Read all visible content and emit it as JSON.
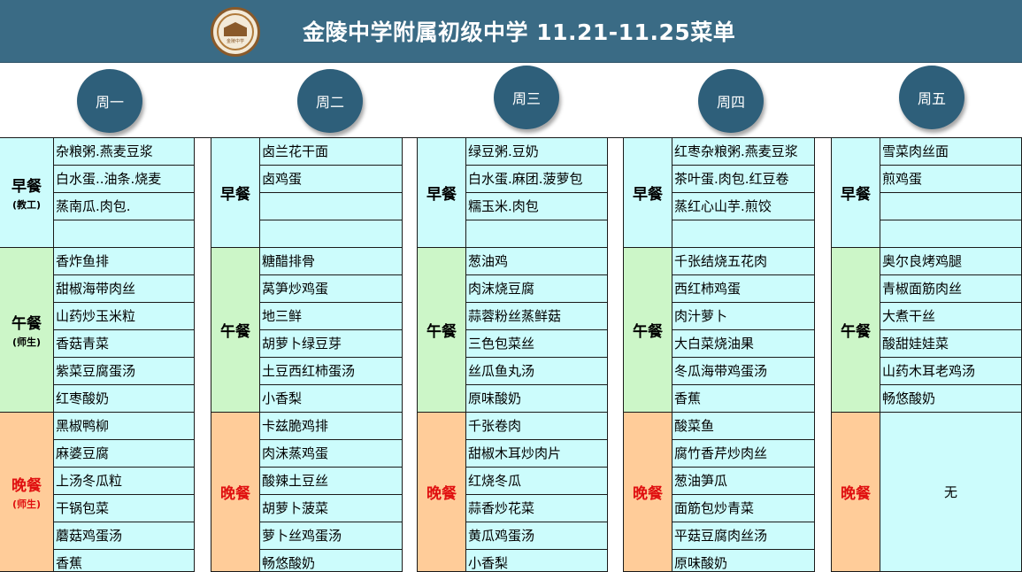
{
  "header": {
    "title": "金陵中学附属初级中学 11.21-11.25菜单",
    "logo_text": "金陵中学",
    "color": "#3a6b85"
  },
  "days": [
    {
      "name": "周一",
      "breakfast": {
        "label": "早餐",
        "sub": "(教工)",
        "items": [
          "杂粮粥.燕麦豆浆",
          "白水蛋..油条.烧麦",
          "蒸南瓜.肉包.",
          ""
        ]
      },
      "lunch": {
        "label": "午餐",
        "sub": "(师生)",
        "items": [
          "香炸鱼排",
          "甜椒海带肉丝",
          "山药炒玉米粒",
          "香菇青菜",
          "紫菜豆腐蛋汤",
          "红枣酸奶"
        ]
      },
      "dinner": {
        "label": "晚餐",
        "sub": "(师生)",
        "items": [
          "黑椒鸭柳",
          "麻婆豆腐",
          "上汤冬瓜粒",
          "干锅包菜",
          "蘑菇鸡蛋汤",
          "香蕉"
        ]
      }
    },
    {
      "name": "周二",
      "breakfast": {
        "label": "早餐",
        "sub": "",
        "items": [
          "卤兰花干面",
          "卤鸡蛋",
          "",
          ""
        ]
      },
      "lunch": {
        "label": "午餐",
        "sub": "",
        "items": [
          "糖醋排骨",
          "莴笋炒鸡蛋",
          "地三鲜",
          "胡萝卜绿豆芽",
          "土豆西红柿蛋汤",
          "小香梨"
        ]
      },
      "dinner": {
        "label": "晚餐",
        "sub": "",
        "items": [
          "卡兹脆鸡排",
          "肉沫蒸鸡蛋",
          "酸辣土豆丝",
          "胡萝卜菠菜",
          "萝卜丝鸡蛋汤",
          "畅悠酸奶"
        ]
      }
    },
    {
      "name": "周三",
      "breakfast": {
        "label": "早餐",
        "sub": "",
        "items": [
          "绿豆粥.豆奶",
          "白水蛋.麻团.菠萝包",
          "糯玉米.肉包",
          ""
        ]
      },
      "lunch": {
        "label": "午餐",
        "sub": "",
        "items": [
          "葱油鸡",
          "肉沫烧豆腐",
          "蒜蓉粉丝蒸鲜菇",
          "三色包菜丝",
          "丝瓜鱼丸汤",
          "原味酸奶"
        ]
      },
      "dinner": {
        "label": "晚餐",
        "sub": "",
        "items": [
          "千张卷肉",
          "甜椒木耳炒肉片",
          "红烧冬瓜",
          "蒜香炒花菜",
          "黄瓜鸡蛋汤",
          "小香梨"
        ]
      }
    },
    {
      "name": "周四",
      "breakfast": {
        "label": "早餐",
        "sub": "",
        "items": [
          "红枣杂粮粥.燕麦豆浆",
          "茶叶蛋.肉包.红豆卷",
          "蒸红心山芋.煎饺",
          ""
        ]
      },
      "lunch": {
        "label": "午餐",
        "sub": "",
        "items": [
          "千张结烧五花肉",
          "西红柿鸡蛋",
          "肉汁萝卜",
          "大白菜烧油果",
          "冬瓜海带鸡蛋汤",
          "香蕉"
        ]
      },
      "dinner": {
        "label": "晚餐",
        "sub": "",
        "items": [
          "酸菜鱼",
          "腐竹香芹炒肉丝",
          "葱油笋瓜",
          "面筋包炒青菜",
          "平菇豆腐肉丝汤",
          "原味酸奶"
        ]
      }
    },
    {
      "name": "周五",
      "breakfast": {
        "label": "早餐",
        "sub": "",
        "items": [
          "雪菜肉丝面",
          "煎鸡蛋",
          "",
          ""
        ]
      },
      "lunch": {
        "label": "午餐",
        "sub": "",
        "items": [
          "奥尔良烤鸡腿",
          "青椒面筋肉丝",
          "大煮干丝",
          "酸甜娃娃菜",
          "山药木耳老鸡汤",
          "畅悠酸奶"
        ]
      },
      "dinner": {
        "label": "晚餐",
        "sub": "",
        "items": [],
        "none_text": "无"
      }
    }
  ]
}
